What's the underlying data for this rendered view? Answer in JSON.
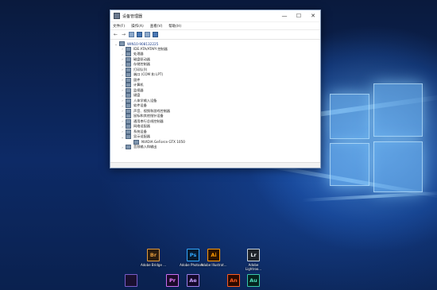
{
  "window": {
    "title": "设备管理器",
    "controls": {
      "minimize": "—",
      "maximize": "☐",
      "close": "✕"
    },
    "menu": [
      "文件(F)",
      "操作(A)",
      "查看(V)",
      "帮助(H)"
    ],
    "toolbar": {
      "back": "←",
      "forward": "→"
    },
    "tree": {
      "root": "WIN10-908132225",
      "root_expand": "⌄",
      "items": [
        {
          "label": "IDE ATA/ATAPI 控制器",
          "expand": "›"
        },
        {
          "label": "处理器",
          "expand": "›"
        },
        {
          "label": "磁盘驱动器",
          "expand": "›"
        },
        {
          "label": "存储控制器",
          "expand": "›"
        },
        {
          "label": "打印队列",
          "expand": "›"
        },
        {
          "label": "端口 (COM 和 LPT)",
          "expand": "›"
        },
        {
          "label": "固件",
          "expand": "›"
        },
        {
          "label": "计算机",
          "expand": "›"
        },
        {
          "label": "监视器",
          "expand": "›"
        },
        {
          "label": "键盘",
          "expand": "›"
        },
        {
          "label": "人体学输入设备",
          "expand": "›"
        },
        {
          "label": "软件设备",
          "expand": "›"
        },
        {
          "label": "声音、视频和游戏控制器",
          "expand": "›"
        },
        {
          "label": "鼠标和其他指针设备",
          "expand": "›"
        },
        {
          "label": "通用串行总线控制器",
          "expand": "›"
        },
        {
          "label": "网络适配器",
          "expand": "›"
        },
        {
          "label": "系统设备",
          "expand": "›"
        },
        {
          "label": "显示适配器",
          "expand": "⌄"
        },
        {
          "label": "NVIDIA GeForce GTX 1050",
          "expand": "",
          "child": true
        },
        {
          "label": "音频输入和输出",
          "expand": "›"
        }
      ]
    }
  },
  "desktop_icons": [
    {
      "abbr": "Br",
      "label": "Adobe Bridge ...",
      "bg": "#2b1c0f",
      "fg": "#e39b3c",
      "border": "#e39b3c"
    },
    {
      "abbr": "Ps",
      "label": "Adobe Photosh...",
      "bg": "#071a2e",
      "fg": "#31a8ff",
      "border": "#31a8ff"
    },
    {
      "abbr": "Ai",
      "label": "Adobe Illustrat...",
      "bg": "#2b1300",
      "fg": "#ff9a00",
      "border": "#ff9a00"
    },
    {
      "abbr": "Lr",
      "label": "Adobe Lightroo...",
      "bg": "#1d2229",
      "fg": "#e8eef3",
      "border": "#c9d3dc"
    },
    {
      "abbr": "",
      "label": "",
      "bg": "#1a1030",
      "fg": "#b78cff",
      "border": "#7a5cc8"
    },
    {
      "abbr": "Pr",
      "label": "",
      "bg": "#1c0b2a",
      "fg": "#e77bff",
      "border": "#c86df0"
    },
    {
      "abbr": "Ae",
      "label": "",
      "bg": "#15082a",
      "fg": "#c6a2ff",
      "border": "#9b7ee8"
    },
    {
      "abbr": "An",
      "label": "",
      "bg": "#2b0a00",
      "fg": "#ff5a1f",
      "border": "#ff5a1f"
    },
    {
      "abbr": "Au",
      "label": "",
      "bg": "#05231f",
      "fg": "#4fe3c3",
      "border": "#38c7aa"
    }
  ]
}
